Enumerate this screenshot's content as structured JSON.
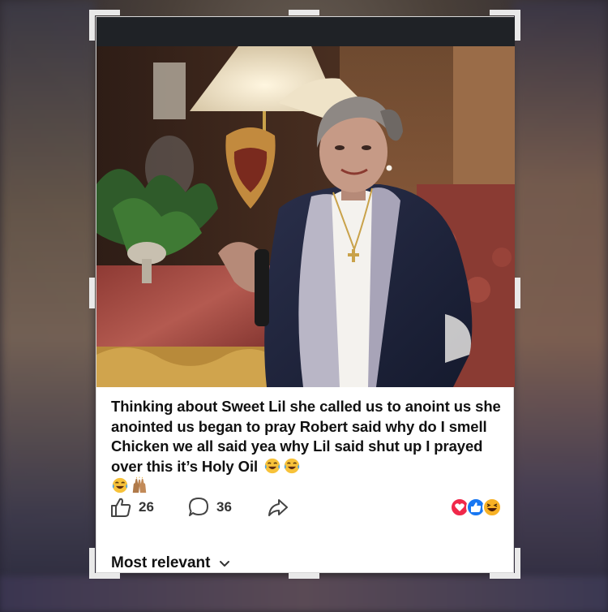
{
  "post": {
    "caption": "Thinking about Sweet Lil she called us to anoint us she anointed us began to pray Robert said why do I smell Chicken we all said yea why Lil said shut up I prayed over this it’s Holy Oil",
    "caption_emojis": [
      "laughing-with-tears",
      "laughing-with-tears",
      "laughing-with-tears",
      "raised-hands"
    ]
  },
  "actions": {
    "like_icon": "thumbs-up-icon",
    "like_count": "26",
    "comment_icon": "comment-bubble-icon",
    "comment_count": "36",
    "share_icon": "share-arrow-icon"
  },
  "reactions": [
    "love",
    "like",
    "haha"
  ],
  "comments": {
    "sort_label": "Most relevant"
  },
  "colors": {
    "love": "#f0284a",
    "like": "#1877f2",
    "haha": "#f7b125",
    "topbar": "#1f2226"
  }
}
